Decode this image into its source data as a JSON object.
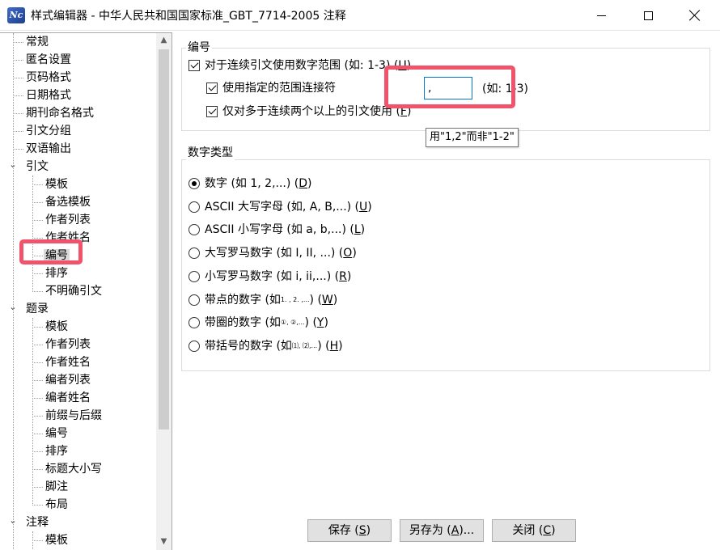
{
  "window": {
    "title": "样式编辑器 - 中华人民共和国国家标准_GBT_7714-2005 注释",
    "icon_text": "Nc"
  },
  "tree": {
    "items": [
      {
        "label": "常规",
        "level": 1
      },
      {
        "label": "匿名设置",
        "level": 1
      },
      {
        "label": "页码格式",
        "level": 1
      },
      {
        "label": "日期格式",
        "level": 1
      },
      {
        "label": "期刊命名格式",
        "level": 1
      },
      {
        "label": "引文分组",
        "level": 1
      },
      {
        "label": "双语输出",
        "level": 1
      },
      {
        "label": "引文",
        "level": 1,
        "expanded": true
      },
      {
        "label": "模板",
        "level": 2
      },
      {
        "label": "备选模板",
        "level": 2
      },
      {
        "label": "作者列表",
        "level": 2
      },
      {
        "label": "作者姓名",
        "level": 2
      },
      {
        "label": "编号",
        "level": 2,
        "selected": true
      },
      {
        "label": "排序",
        "level": 2
      },
      {
        "label": "不明确引文",
        "level": 2
      },
      {
        "label": "题录",
        "level": 1,
        "expanded": true
      },
      {
        "label": "模板",
        "level": 2
      },
      {
        "label": "作者列表",
        "level": 2
      },
      {
        "label": "作者姓名",
        "level": 2
      },
      {
        "label": "编者列表",
        "level": 2
      },
      {
        "label": "编者姓名",
        "level": 2
      },
      {
        "label": "前缀与后缀",
        "level": 2
      },
      {
        "label": "编号",
        "level": 2
      },
      {
        "label": "排序",
        "level": 2
      },
      {
        "label": "标题大小写",
        "level": 2
      },
      {
        "label": "脚注",
        "level": 2
      },
      {
        "label": "布局",
        "level": 2
      },
      {
        "label": "注释",
        "level": 1,
        "expanded": true
      },
      {
        "label": "模板",
        "level": 2
      }
    ]
  },
  "numbering": {
    "group_title": "编号",
    "use_number_range": {
      "label": "对于连续引文使用数字范围 (如: 1-3) (",
      "key": "U",
      "suffix": ")",
      "checked": true
    },
    "use_range_separator": {
      "label": "使用指定的范围连接符",
      "checked": true
    },
    "separator_value": ",",
    "separator_example": "(如: 1-3)",
    "only_more_than_two": {
      "label": "仅对多于连续两个以上的引文使用 (",
      "key": "F",
      "suffix": ")",
      "checked": true
    },
    "tooltip": "用\"1,2\"而非\"1-2\""
  },
  "number_type": {
    "group_title": "数字类型",
    "options": [
      {
        "label": "数字 (如 1, 2,...) (",
        "key": "D",
        "suffix": ")",
        "checked": true
      },
      {
        "label": "ASCII 大写字母 (如, A, B,...) (",
        "key": "U",
        "suffix": ")",
        "checked": false
      },
      {
        "label": "ASCII 小写字母 (如 a, b,...) (",
        "key": "L",
        "suffix": ")",
        "checked": false
      },
      {
        "label": "大写罗马数字 (如 I, II, ...) (",
        "key": "O",
        "suffix": ")",
        "checked": false
      },
      {
        "label": "小写罗马数字 (如 i, ii,...) (",
        "key": "R",
        "suffix": ")",
        "checked": false
      },
      {
        "label": "带点的数字 (如 ",
        "sample": "1. , 2. ,...",
        "rest": ") (",
        "key": "W",
        "suffix": ")",
        "checked": false
      },
      {
        "label": "带圈的数字 (如 ",
        "sample": "①, ②,...",
        "rest": ") (",
        "key": "Y",
        "suffix": ")",
        "checked": false
      },
      {
        "label": "带括号的数字 (如 ",
        "sample": "⑴, ⑵,...",
        "rest": ") (",
        "key": "H",
        "suffix": ")",
        "checked": false
      }
    ]
  },
  "buttons": {
    "save": {
      "label": "保存 (",
      "key": "S",
      "suffix": ")"
    },
    "save_as": {
      "label": "另存为 (",
      "key": "A",
      "suffix": ")..."
    },
    "close": {
      "label": "关闭 (",
      "key": "C",
      "suffix": ")"
    }
  },
  "colors": {
    "highlight": "#f1546a",
    "input_focus": "#0078d7",
    "selected_bg": "#d9d9d9"
  }
}
